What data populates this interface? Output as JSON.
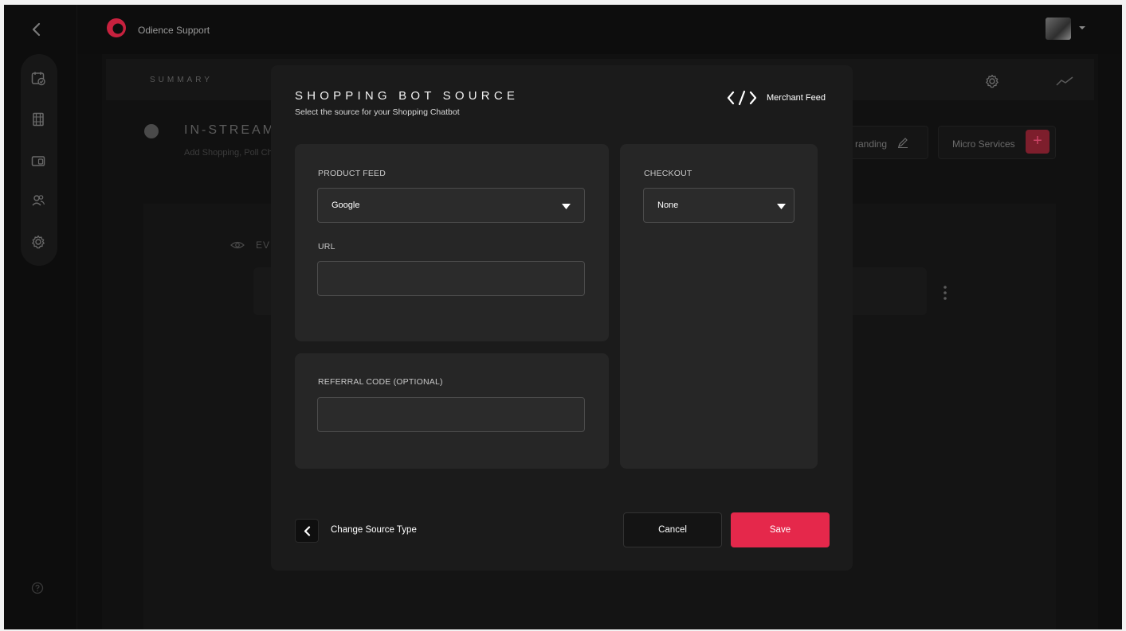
{
  "app": {
    "org_name": "Odience Support"
  },
  "summary": {
    "label": "SUMMARY"
  },
  "stream": {
    "title": "IN-STREAM S",
    "subtitle": "Add Shopping, Poll Ch",
    "branding_label": "randing",
    "micro_services_label": "Micro Services",
    "micro_services_plus": "+",
    "eve_label": "EVE"
  },
  "modal": {
    "title": "SHOPPING BOT SOURCE",
    "subtitle": "Select the source for your Shopping Chatbot",
    "merchant_feed_label": "Merchant Feed",
    "product_feed": {
      "label": "PRODUCT FEED",
      "selected": "Google"
    },
    "url": {
      "label": "URL",
      "value": "",
      "placeholder": ""
    },
    "referral": {
      "label": "REFERRAL CODE (OPTIONAL)",
      "value": "",
      "placeholder": ""
    },
    "checkout": {
      "label": "CHECKOUT",
      "selected": "None"
    },
    "change_source_label": "Change Source Type",
    "cancel_label": "Cancel",
    "save_label": "Save"
  },
  "colors": {
    "accent": "#e5284b",
    "modal_bg": "#1b1b1b",
    "card_bg": "#262626",
    "input_border": "#4c4c4c",
    "app_bg": "#0e0e0e"
  },
  "icons": {
    "rail": [
      "calendar-check-icon",
      "film-icon",
      "devices-icon",
      "users-icon",
      "gear-icon"
    ],
    "help": "help-icon",
    "code": "code-icon"
  }
}
